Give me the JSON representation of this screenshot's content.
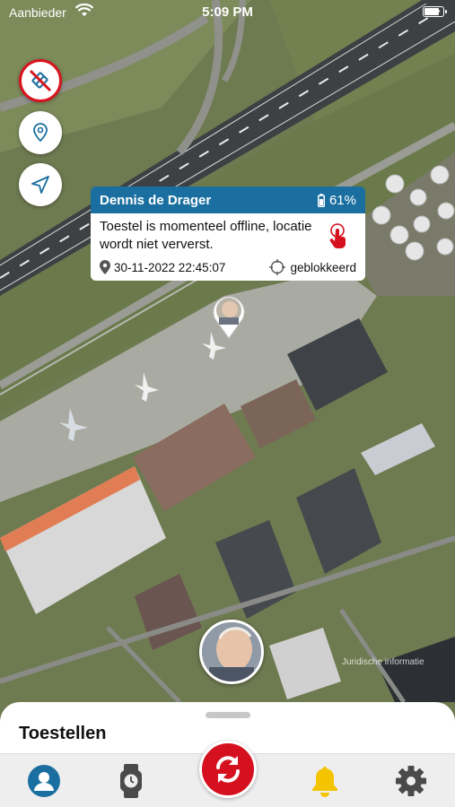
{
  "status_bar": {
    "carrier": "Aanbieder",
    "time": "5:09 PM",
    "battery_level": 0.85
  },
  "map_controls": [
    {
      "icon": "geofence-off-icon",
      "color": "#d7141e"
    },
    {
      "icon": "map-pin-icon",
      "color": "#1a6fa0"
    },
    {
      "icon": "navigation-arrow-icon",
      "color": "#1a6fa0"
    }
  ],
  "popup": {
    "name": "Dennis de Drager",
    "battery": "61%",
    "message": "Toestel is momenteel offline, locatie wordt niet ververst.",
    "datetime": "30-11-2022 22:45:07",
    "lock_status": "geblokkeerd",
    "header_color": "#1a6fa0",
    "accent_color": "#d5111f"
  },
  "map": {
    "attribution": "Juridische informatie"
  },
  "sheet": {
    "title": "Toestellen"
  },
  "tab_bar": {
    "items": [
      {
        "icon": "user-profile-icon",
        "color": "#1a6fa0",
        "active": true
      },
      {
        "icon": "smartwatch-icon",
        "color": "#4a4a4a",
        "active": false
      },
      {
        "icon": "refresh-icon",
        "color": "#d5111f",
        "active": false
      },
      {
        "icon": "bell-icon",
        "color": "#f5c400",
        "active": false
      },
      {
        "icon": "gear-icon",
        "color": "#4a4a4a",
        "active": false
      }
    ]
  }
}
